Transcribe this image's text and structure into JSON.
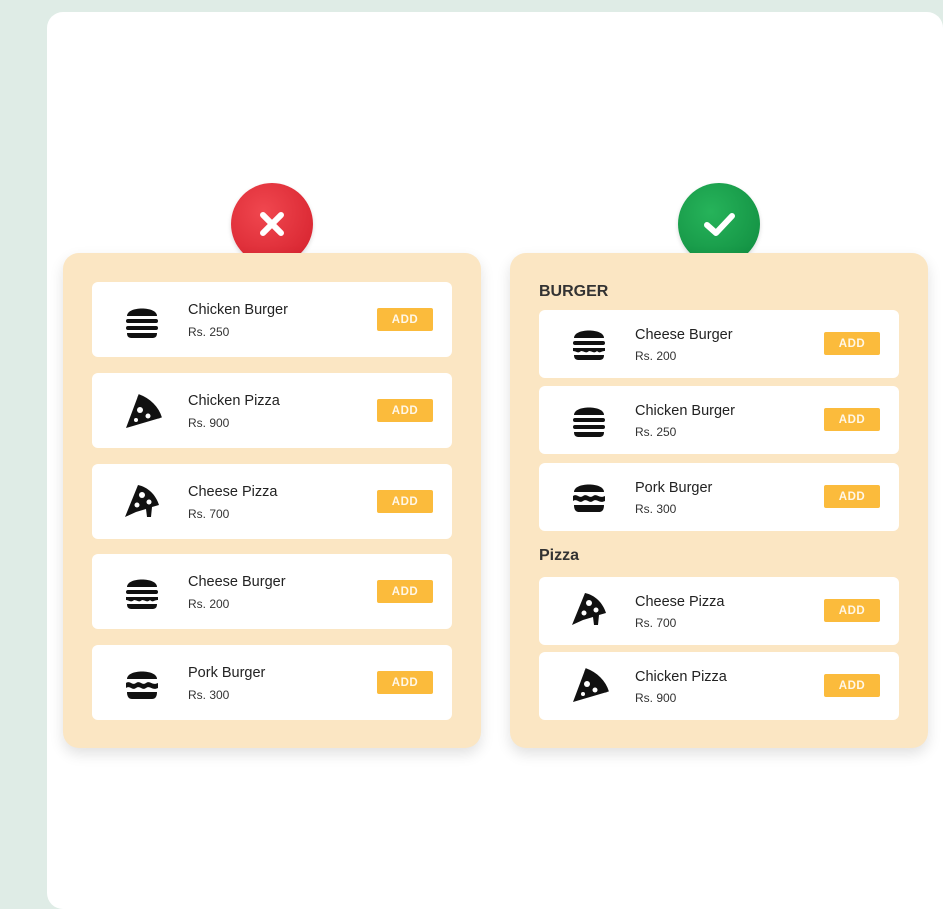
{
  "badges": {
    "bad": "close-icon",
    "good": "check-icon"
  },
  "left_panel": {
    "items": [
      {
        "name": "Chicken Burger",
        "price": "Rs. 250",
        "icon": "burger-icon",
        "add_label": "ADD"
      },
      {
        "name": "Chicken Pizza",
        "price": "Rs. 900",
        "icon": "pizza-icon",
        "add_label": "ADD"
      },
      {
        "name": "Cheese Pizza",
        "price": "Rs. 700",
        "icon": "pizza-slice-icon",
        "add_label": "ADD"
      },
      {
        "name": "Cheese Burger",
        "price": "Rs. 200",
        "icon": "cheese-burger-icon",
        "add_label": "ADD"
      },
      {
        "name": "Pork Burger",
        "price": "Rs. 300",
        "icon": "pork-burger-icon",
        "add_label": "ADD"
      }
    ]
  },
  "right_panel": {
    "sections": [
      {
        "title": "BURGER",
        "items": [
          {
            "name": "Cheese Burger",
            "price": "Rs. 200",
            "icon": "cheese-burger-icon",
            "add_label": "ADD"
          },
          {
            "name": "Chicken Burger",
            "price": "Rs. 250",
            "icon": "burger-icon",
            "add_label": "ADD"
          },
          {
            "name": "Pork Burger",
            "price": "Rs. 300",
            "icon": "pork-burger-icon",
            "add_label": "ADD"
          }
        ]
      },
      {
        "title": "Pizza",
        "items": [
          {
            "name": "Cheese Pizza",
            "price": "Rs. 700",
            "icon": "pizza-slice-icon",
            "add_label": "ADD"
          },
          {
            "name": "Chicken Pizza",
            "price": "Rs. 900",
            "icon": "pizza-icon",
            "add_label": "ADD"
          }
        ]
      }
    ]
  },
  "colors": {
    "page_bg": "#dfece6",
    "panel_bg": "#fbe6c3",
    "add_button": "#fbbb3c",
    "bad_badge": "#e02a35",
    "good_badge": "#189b48"
  }
}
